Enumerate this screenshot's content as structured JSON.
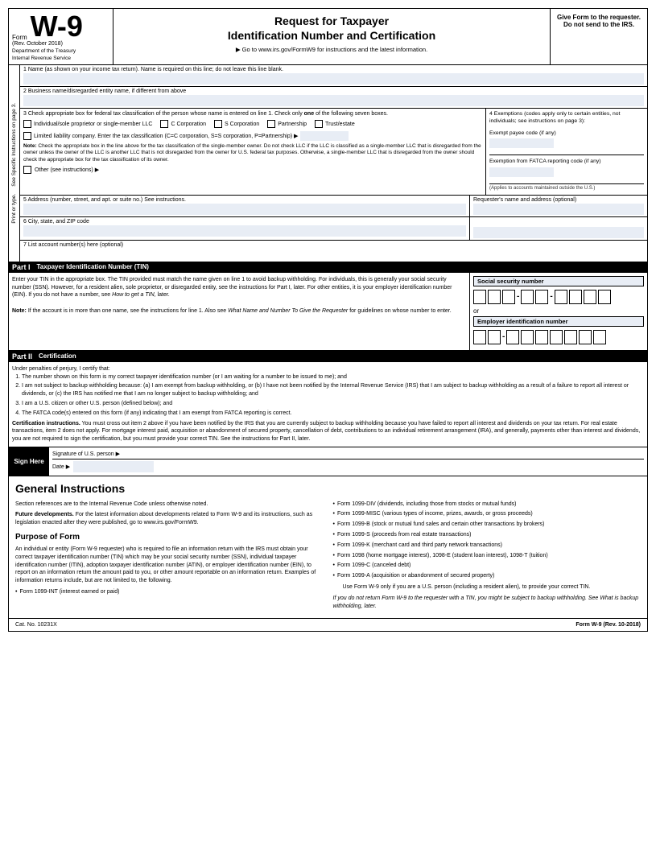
{
  "header": {
    "form_label": "Form",
    "form_name": "W-9",
    "rev_date": "(Rev. October 2018)",
    "dept1": "Department of the Treasury",
    "dept2": "Internal Revenue Service",
    "main_title_line1": "Request for Taxpayer",
    "main_title_line2": "Identification Number and Certification",
    "url_line": "▶ Go to www.irs.gov/FormW9 for instructions and the latest information.",
    "give_form": "Give Form to the requester. Do not send to the IRS."
  },
  "fields": {
    "line1_label": "1  Name (as shown on your income tax return). Name is required on this line; do not leave this line blank.",
    "line2_label": "2  Business name/disregarded entity name, if different from above",
    "line3_label": "3  Check appropriate box for federal tax classification of the person whose name is entered on line 1. Check only",
    "line3_label2": "one",
    "line3_label3": "of the following seven boxes.",
    "checkbox_individual": "Individual/sole proprietor or single-member LLC",
    "checkbox_c_corp": "C Corporation",
    "checkbox_s_corp": "S Corporation",
    "checkbox_partnership": "Partnership",
    "checkbox_trust": "Trust/estate",
    "llc_label": "Limited liability company. Enter the tax classification (C=C corporation, S=S corporation, P=Partnership) ▶",
    "note_bold": "Note:",
    "note_text": "Check the appropriate box in the line above for the tax classification of the single-member owner.  Do not check LLC if the LLC is classified as a single-member LLC that is disregarded from the owner unless the owner of the LLC is another LLC that is not disregarded from the owner for U.S. federal tax purposes. Otherwise, a single-member LLC that is disregarded from the owner should check the appropriate box for the tax classification of its owner.",
    "other_label": "Other (see instructions) ▶",
    "line4_label": "4  Exemptions (codes apply only to certain entities, not individuals; see instructions on page 3):",
    "exempt_payee_label": "Exempt payee code (if any)",
    "fatca_label": "Exemption from FATCA reporting code (if any)",
    "fatca_applies": "(Applies to accounts maintained outside the U.S.)",
    "line5_label": "5  Address (number, street, and apt. or suite no.) See instructions.",
    "line5_right": "Requester's name and address (optional)",
    "line6_label": "6  City, state, and ZIP code",
    "line7_label": "7  List account number(s) here (optional)"
  },
  "sidebar": {
    "print_type": "Print or type.",
    "see_specific": "See Specific Instructions on page 3."
  },
  "part1": {
    "label": "Part I",
    "title": "Taxpayer Identification Number (TIN)",
    "description": "Enter your TIN in the appropriate box. The TIN provided must match the name given on line 1 to avoid backup withholding. For individuals, this is generally your social security number (SSN). However, for a resident alien, sole proprietor, or disregarded entity, see the instructions for Part I, later. For other entities, it is your employer identification number (EIN). If you do not have a number, see",
    "desc_italic": "How to get a TIN,",
    "desc_end": "later.",
    "note_label": "Note:",
    "note_text": "If the account is in more than one name, see the instructions for line 1. Also see",
    "note_italic": "What Name and Number To Give the Requester",
    "note_end": "for guidelines on whose number to enter.",
    "ssn_label": "Social security number",
    "or_text": "or",
    "ein_label": "Employer identification number"
  },
  "part2": {
    "label": "Part II",
    "title": "Certification",
    "perjury_intro": "Under penalties of perjury, I certify that:",
    "items": [
      "The number shown on this form is my correct taxpayer identification number (or I am waiting for a number to be issued to me); and",
      "I am not subject to backup withholding because: (a) I am exempt from backup withholding, or (b) I have not been notified by the Internal Revenue Service (IRS) that I am subject to backup withholding as a result of a failure to report all interest or dividends, or (c) the IRS has notified me that I am no longer subject to backup withholding; and",
      "I am a U.S. citizen or other U.S. person (defined below); and",
      "The FATCA code(s) entered on this form (if any) indicating that I am exempt from FATCA reporting is correct."
    ],
    "cert_bold": "Certification instructions.",
    "cert_text": "You must cross out item 2 above if you have been notified by the IRS that you are currently subject to backup withholding because you have failed to report all interest and dividends on your tax return. For real estate transactions, item 2 does not apply. For mortgage interest paid, acquisition or abandonment of secured property, cancellation of debt, contributions to an individual retirement arrangement (IRA), and generally, payments other than interest and dividends, you are not required to sign the certification, but you must provide your correct TIN. See the instructions for Part II, later."
  },
  "sign": {
    "sign_here": "Sign Here",
    "sig_label": "Signature of U.S. person ▶",
    "date_label": "Date ▶"
  },
  "instructions": {
    "title": "General Instructions",
    "intro": "Section references are to the Internal Revenue Code unless otherwise noted.",
    "future_bold": "Future developments.",
    "future_text": "For the latest information about developments related to Form W-9 and its instructions, such as legislation enacted after they were published, go to",
    "future_url": "www.irs.gov/FormW9.",
    "purpose_title": "Purpose of Form",
    "purpose_text": "An individual or entity (Form W-9 requester) who is required to file an information return with the IRS must obtain your correct taxpayer identification number (TIN) which may be your social security number (SSN), individual taxpayer identification number (ITIN), adoption taxpayer identification number (ATIN), or employer identification number (EIN), to report on an information return the amount paid to you, or other amount reportable on an information return. Examples of information returns include, but are not limited to, the following.",
    "bullet1": "Form 1099-INT (interest earned or paid)",
    "right_bullets": [
      "Form 1099-DIV (dividends, including those from stocks or mutual funds)",
      "Form 1099-MISC (various types of income, prizes, awards, or gross proceeds)",
      "Form 1099-B (stock or mutual fund sales and certain other transactions by brokers)",
      "Form 1099-S (proceeds from real estate transactions)",
      "Form 1099-K (merchant card and third party network transactions)",
      "Form 1098 (home mortgage interest), 1098-E (student loan interest), 1098-T (tuition)",
      "Form 1099-C (canceled debt)",
      "Form 1099-A (acquisition or abandonment of secured property)"
    ],
    "use_w9_text": "Use Form W-9 only if you are a U.S. person (including a resident alien), to provide your correct TIN.",
    "italic_text": "If you do not return Form W-9 to the requester with a TIN, you might be subject to backup withholding. See What is backup withholding, later.",
    "cat_no": "Cat. No. 10231X",
    "form_id": "Form W-9 (Rev. 10-2018)"
  }
}
